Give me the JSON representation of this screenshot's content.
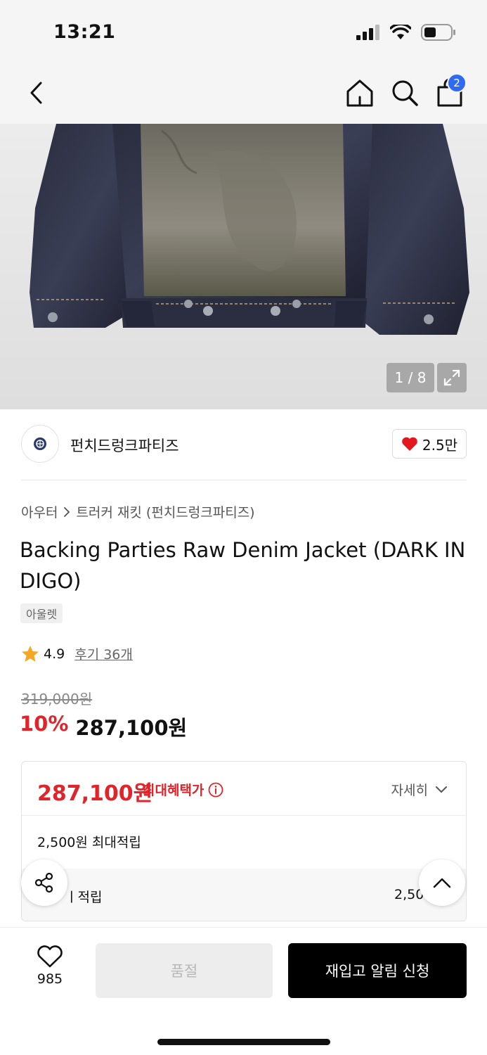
{
  "status": {
    "time": "13:21"
  },
  "nav": {
    "cart_count": "2"
  },
  "gallery": {
    "counter": "1 / 8"
  },
  "brand": {
    "name": "펀치드렁크파티즈",
    "likes": "2.5만"
  },
  "breadcrumb": {
    "category": "아우터",
    "subcategory": "트러커 재킷 (펀치드렁크파티즈)"
  },
  "product": {
    "title": "Backing Parties Raw Denim Jacket (DARK INDIGO)",
    "tag": "아울렛",
    "rating": "4.9",
    "reviews": "후기 36개",
    "original_price": "319,000원",
    "discount": "10%",
    "price": "287,100원"
  },
  "benefit": {
    "max_price": "287,100원",
    "max_label": "최대혜택가",
    "detail_label": "자세히",
    "max_points": "2,500원 최대적립",
    "row_label": "ㅣ적립",
    "row_value": "2,50"
  },
  "bottom": {
    "wish_count": "985",
    "soldout_label": "품절",
    "restock_label": "재입고 알림 신청"
  },
  "colors": {
    "accent_red": "#e0242a",
    "badge_blue": "#2f6bf2"
  }
}
